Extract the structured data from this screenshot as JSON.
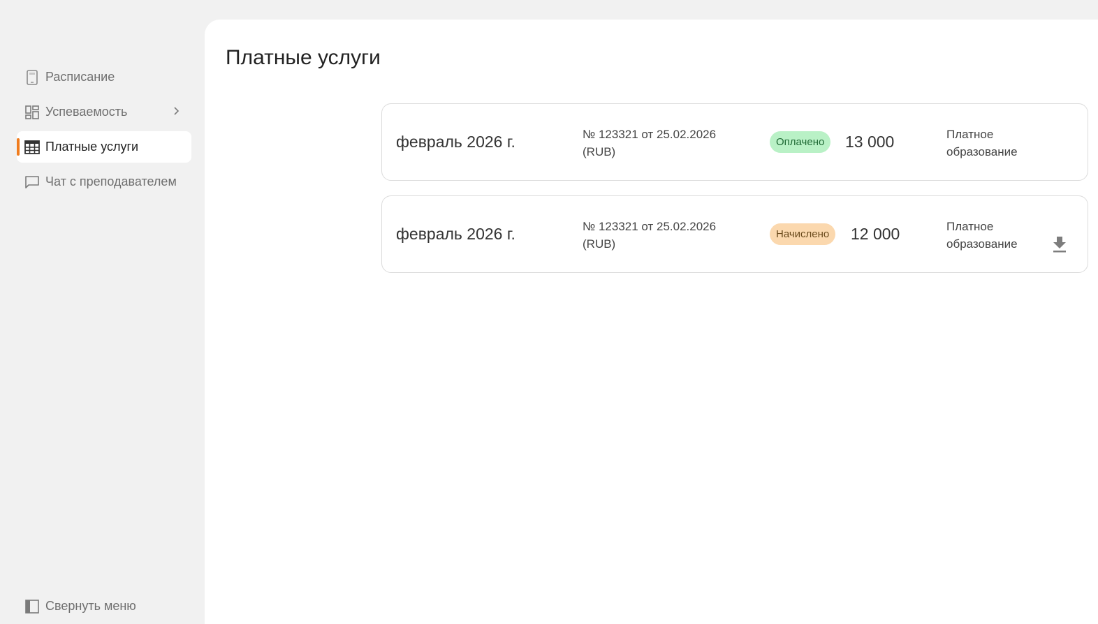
{
  "sidebar": {
    "items": [
      {
        "label": "Расписание",
        "icon": "phone-schedule-icon"
      },
      {
        "label": "Успеваемость",
        "icon": "dashboard-icon"
      },
      {
        "label": "Платные услуги",
        "icon": "table-icon"
      },
      {
        "label": "Чат с преподавателем",
        "icon": "chat-icon"
      }
    ],
    "active_item": "Платные услуги",
    "collapse_label": "Свернуть меню"
  },
  "main": {
    "title": "Платные услуги",
    "payments": [
      {
        "period": "февраль 2026 г.",
        "doc_line1": "№ 123321 от 25.02.2026",
        "doc_line2": "(RUB)",
        "status": "Оплачено",
        "amount": "13 000",
        "service_line1": "Платное",
        "service_line2": "образование",
        "downloadable": false
      },
      {
        "period": "февраль 2026 г.",
        "doc_line1": "№ 123321 от 25.02.2026",
        "doc_line2": "(RUB)",
        "status": "Начислено",
        "amount": "12 000",
        "service_line1": "Платное",
        "service_line2": "образование",
        "downloadable": true
      }
    ]
  },
  "colors": {
    "accent": "#f07c1e",
    "paid_badge_bg": "#b9f1c6",
    "accrued_badge_bg": "#fbd8ae"
  }
}
